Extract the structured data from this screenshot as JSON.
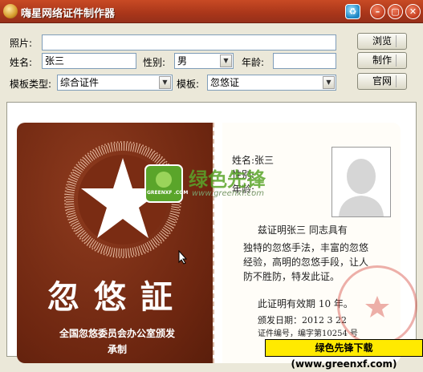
{
  "window": {
    "title": "嗨星网络证件制作器"
  },
  "form": {
    "photo_label": "照片:",
    "photo_value": "",
    "name_label": "姓名:",
    "name_value": "张三",
    "gender_label": "性别:",
    "gender_value": "男",
    "age_label": "年龄:",
    "age_value": "",
    "template_type_label": "模板类型:",
    "template_type_value": "综合证件",
    "template_label": "模板:",
    "template_value": "忽悠证"
  },
  "buttons": {
    "browse": "浏览",
    "make": "制作",
    "website": "官网"
  },
  "card": {
    "big_title": "忽悠証",
    "issuer_line1": "全国忽悠委员会办公室颁发",
    "issuer_line2": "承制",
    "name_field": "姓名:张三",
    "gender_field": "性别:",
    "age_field": "年龄:",
    "cert_line": "兹证明张三     同志具有",
    "body1": "独特的忽悠手法，丰富的忽悠",
    "body2": "经验，高明的忽悠手段，让人",
    "body3": "防不胜防，特发此证。",
    "validity": "此证明有效期  10  年。",
    "issue_date": "颁发日期：2012 3 22",
    "cert_no": "证件编号，编字第10254  号",
    "stamp_text": "全国忽悠委员会办公室"
  },
  "watermark": {
    "brand": "绿色先锋",
    "url": "www.greenxf.com",
    "badge": "GREENXF .COM"
  },
  "banner": {
    "text": "绿色先锋下载(www.greenxf.com)"
  },
  "colors": {
    "title_bar": "#a9361a",
    "card_brown": "#6d2610",
    "banner": "#ffea00",
    "watermark_green": "#5aa52a"
  }
}
